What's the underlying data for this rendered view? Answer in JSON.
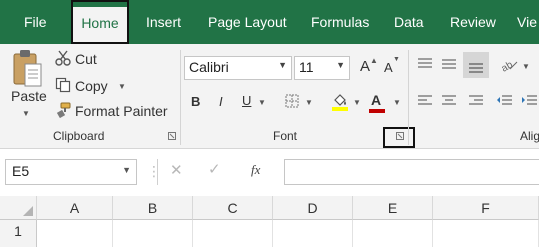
{
  "tabs": [
    "File",
    "Home",
    "Insert",
    "Page Layout",
    "Formulas",
    "Data",
    "Review",
    "Vie"
  ],
  "active_tab": "Home",
  "clipboard": {
    "paste_label": "Paste",
    "cut_label": "Cut",
    "copy_label": "Copy",
    "format_painter_label": "Format Painter",
    "group_label": "Clipboard"
  },
  "font": {
    "font_name": "Calibri",
    "font_size": "11",
    "grow_label": "A",
    "shrink_label": "A",
    "bold_label": "B",
    "italic_label": "I",
    "underline_label": "U",
    "font_color_label": "A",
    "group_label": "Font",
    "highlight_color": "#ffff00",
    "font_color": "#c00000"
  },
  "alignment": {
    "group_label": "Alig"
  },
  "formula_bar": {
    "name_box": "E5",
    "fx_label": "fx",
    "formula": ""
  },
  "grid": {
    "columns": [
      "A",
      "B",
      "C",
      "D",
      "E",
      "F"
    ],
    "rows": [
      "1"
    ]
  },
  "colors": {
    "accent": "#217346",
    "ribbon_bg": "#f3f3f3"
  }
}
